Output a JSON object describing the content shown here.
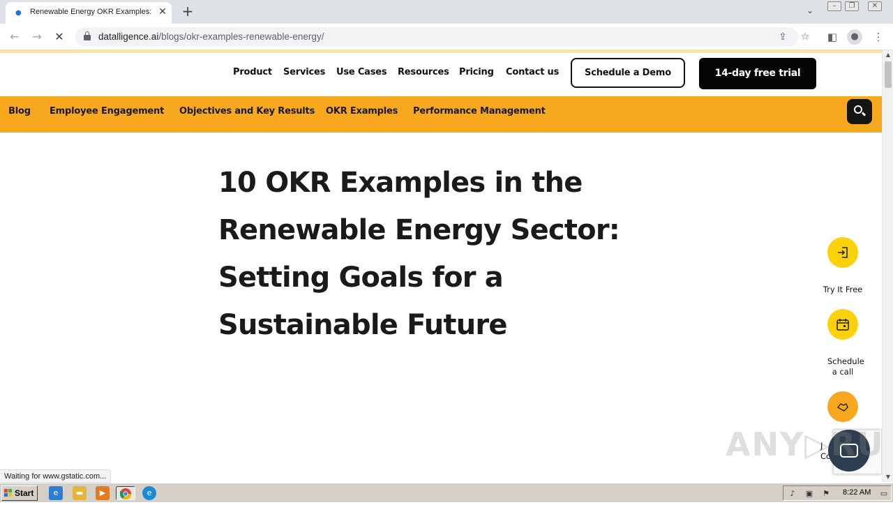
{
  "browser": {
    "tab_title": "Renewable Energy OKR Examples: D",
    "tab_close": "✕",
    "new_tab": "+",
    "url_host": "datalligence.ai",
    "url_path": "/blogs/okr-examples-renewable-energy/",
    "status_text": "Waiting for www.gstatic.com..."
  },
  "site": {
    "nav_items": [
      "Product",
      "Services",
      "Use Cases",
      "Resources",
      "Pricing",
      "Contact us"
    ],
    "schedule_demo_label": "Schedule a Demo",
    "trial_label": "14-day free trial",
    "categories": [
      "Blog",
      "Employee Engagement",
      "Objectives and Key Results",
      "OKR Examples",
      "Performance Management"
    ],
    "headline": "10 OKR Examples in the Renewable Energy Sector: Setting Goals for a Sustainable Future",
    "side_actions": {
      "try_free": "Try It Free",
      "schedule_call": "Schedule a call",
      "partial_label": "J\nCo"
    },
    "watermark": "ANY▷RUN",
    "accent_color": "#f7a81e",
    "side_button_color": "#fbd20a"
  },
  "taskbar": {
    "start_label": "Start",
    "clock": "8:22 AM"
  }
}
